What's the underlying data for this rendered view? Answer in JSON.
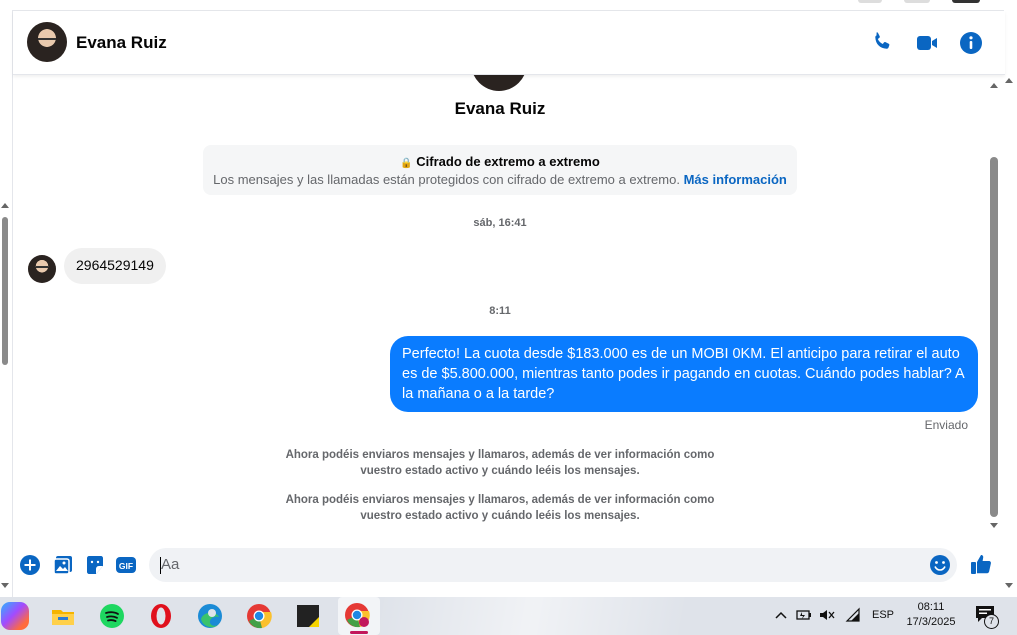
{
  "header": {
    "contact_name": "Evana Ruiz"
  },
  "profile": {
    "name": "Evana Ruiz"
  },
  "encryption": {
    "title": "Cifrado de extremo a extremo",
    "description": "Los mensajes y las llamadas están protegidos con cifrado de extremo a extremo.",
    "link": "Más información"
  },
  "messages": {
    "timestamp_1": "sáb, 16:41",
    "incoming_1": "2964529149",
    "timestamp_2": "8:11",
    "outgoing_1": "Perfecto! La cuota desde $183.000 es de un MOBI 0KM. El anticipo para retirar el auto es de $5.800.000, mientras tanto podes ir pagando en cuotas. Cuándo podes hablar? A la mañana o a la tarde?",
    "status": "Enviado",
    "notice_1": "Ahora podéis enviaros mensajes y llamaros, además de ver información como vuestro estado activo y cuándo leéis los mensajes.",
    "notice_2": "Ahora podéis enviaros mensajes y llamaros, además de ver información como vuestro estado activo y cuándo leéis los mensajes."
  },
  "composer": {
    "placeholder": "Aa"
  },
  "taskbar": {
    "language": "ESP",
    "time": "08:11",
    "date": "17/3/2025",
    "notifications": "7"
  },
  "colors": {
    "accent": "#0a7cff",
    "icon_blue": "#0a66c2",
    "bubble_gray": "#f0f0f0"
  }
}
